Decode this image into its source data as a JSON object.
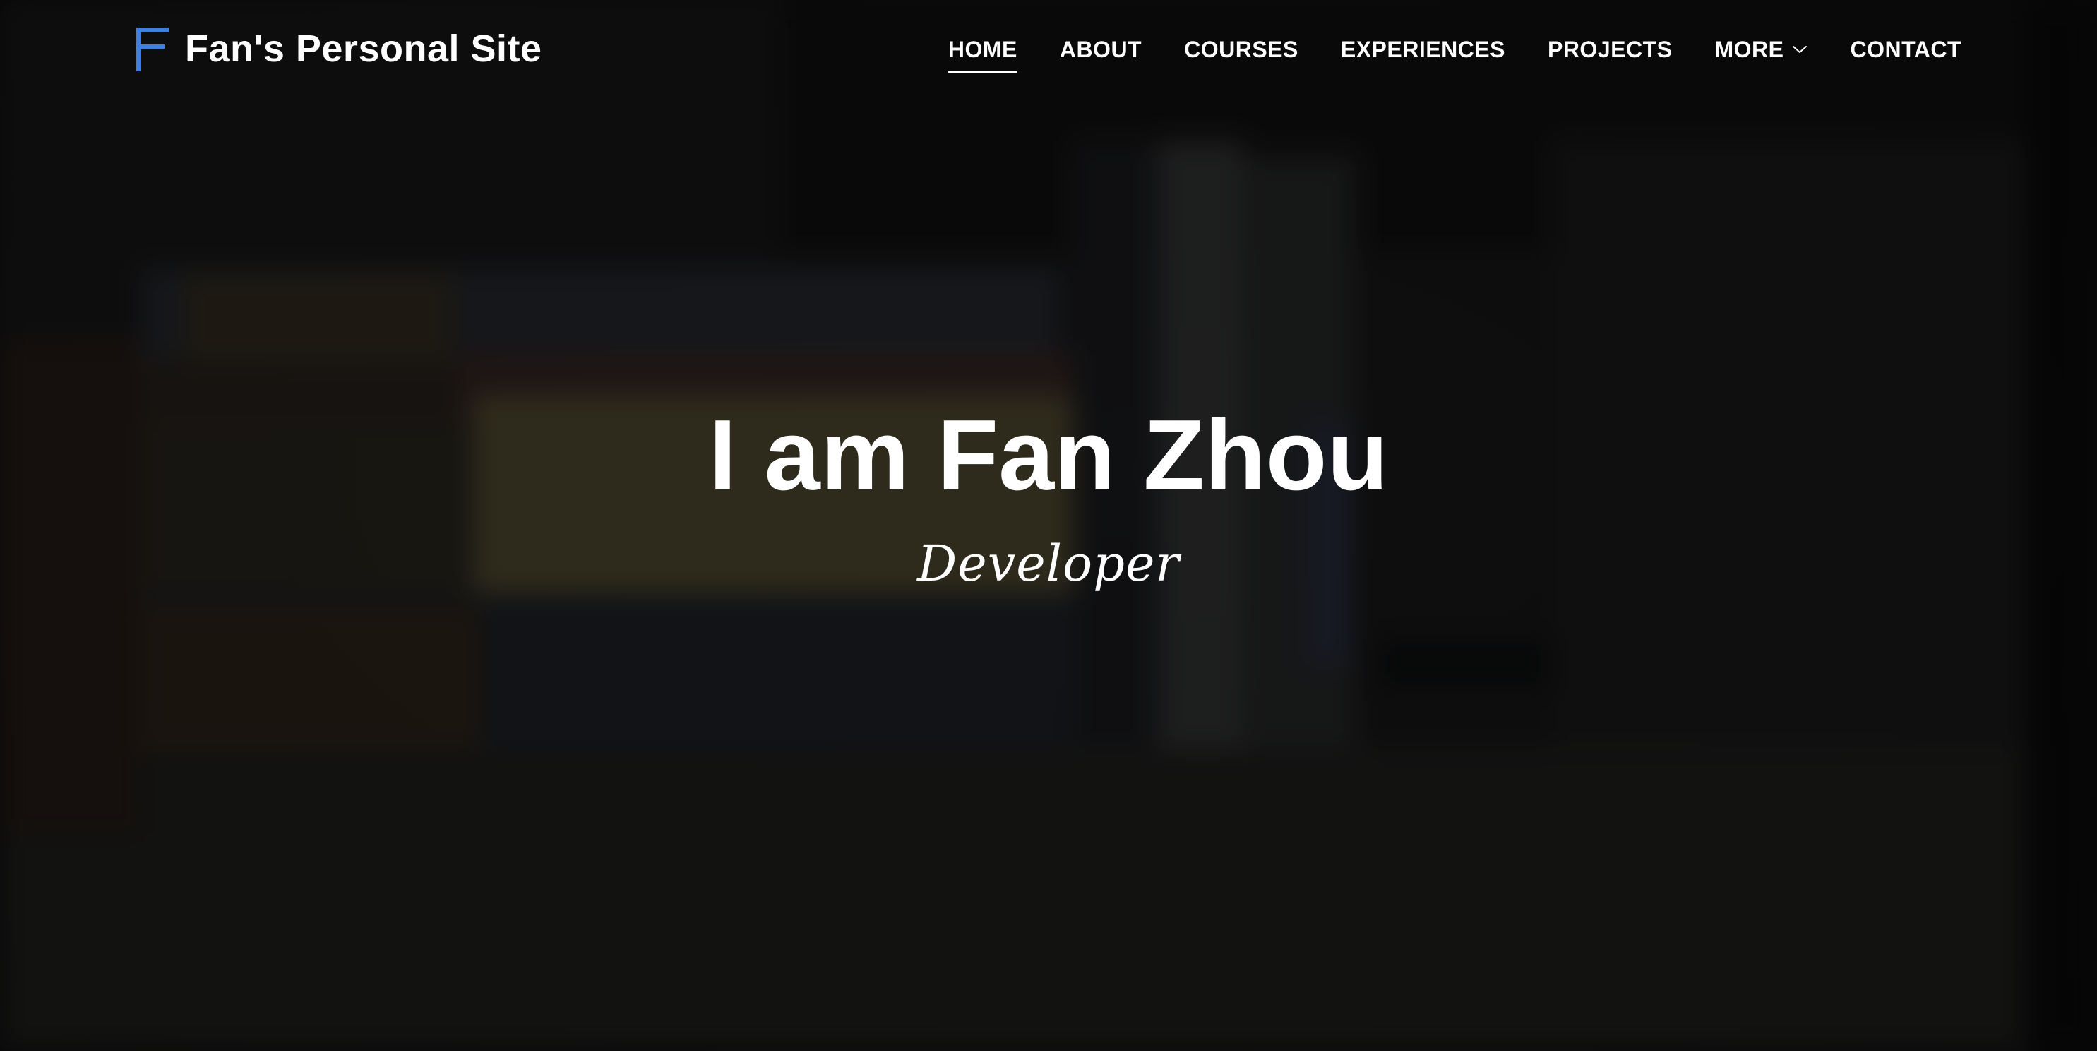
{
  "header": {
    "site_title": "Fan's Personal Site",
    "logo_icon": "letter-f-logo",
    "logo_color": "#3f7fe0"
  },
  "nav": {
    "items": [
      {
        "label": "HOME",
        "active": true
      },
      {
        "label": "ABOUT",
        "active": false
      },
      {
        "label": "COURSES",
        "active": false
      },
      {
        "label": "EXPERIENCES",
        "active": false
      },
      {
        "label": "PROJECTS",
        "active": false
      },
      {
        "label": "MORE",
        "active": false,
        "icon": "chevron-down-icon"
      },
      {
        "label": "CONTACT",
        "active": false
      }
    ]
  },
  "hero": {
    "title": "I am Fan Zhou",
    "subtitle": "Developer"
  }
}
